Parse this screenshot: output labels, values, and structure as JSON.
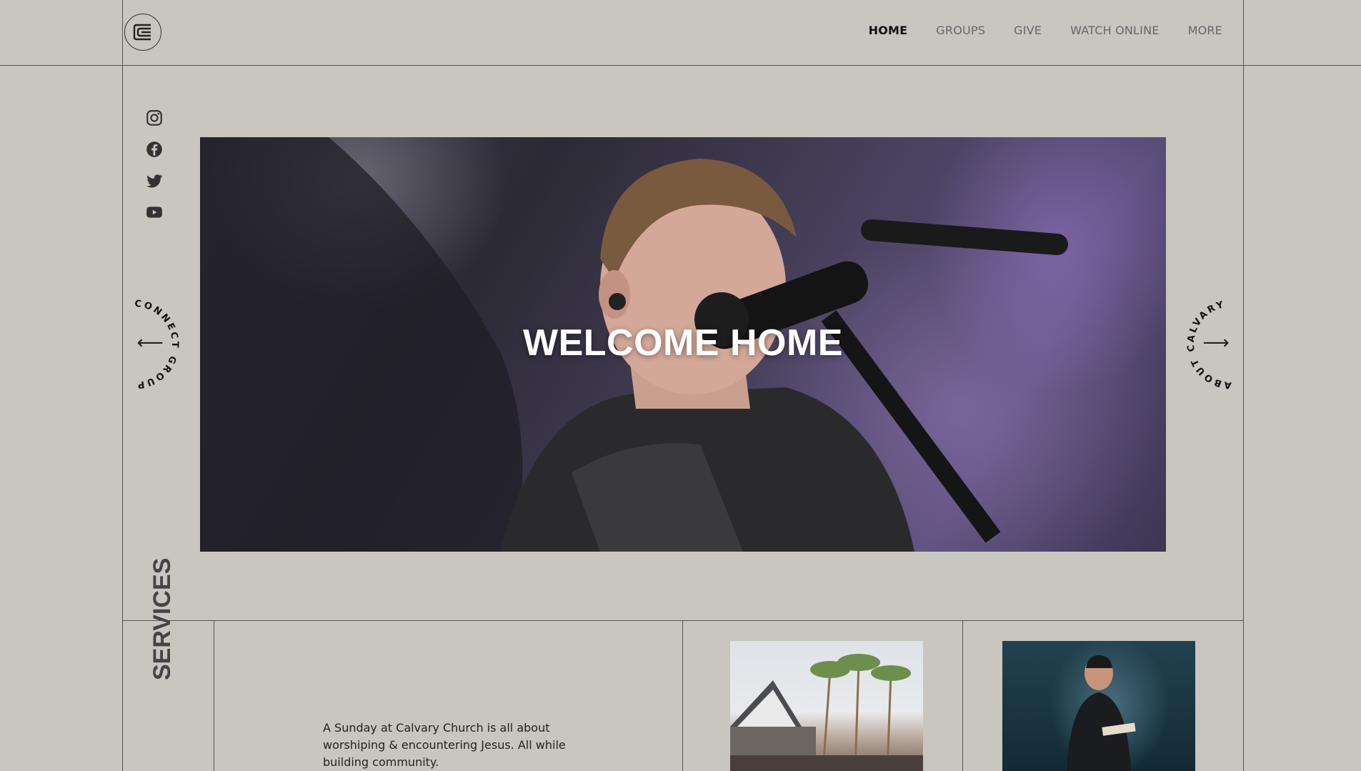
{
  "header": {
    "logo_label": "Calvary Church logo",
    "nav": [
      {
        "label": "HOME",
        "active": true
      },
      {
        "label": "GROUPS",
        "active": false
      },
      {
        "label": "GIVE",
        "active": false
      },
      {
        "label": "WATCH ONLINE",
        "active": false
      },
      {
        "label": "MORE",
        "active": false
      }
    ]
  },
  "social": [
    "instagram-icon",
    "facebook-icon",
    "twitter-icon",
    "youtube-icon"
  ],
  "left_link": {
    "text": "CONNECT GROUPS",
    "arrow": "⟵"
  },
  "right_link": {
    "text": "ABOUT CALVARY",
    "arrow": "⟶"
  },
  "hero": {
    "title": "WELCOME HOME"
  },
  "services": {
    "heading": "SERVICES",
    "text": "A Sunday at Calvary Church is all about worshiping & encountering Jesus. All while building community."
  },
  "colors": {
    "background": "#c8c6bf",
    "line": "#555555",
    "nav_active": "#111111",
    "nav": "#666666"
  }
}
